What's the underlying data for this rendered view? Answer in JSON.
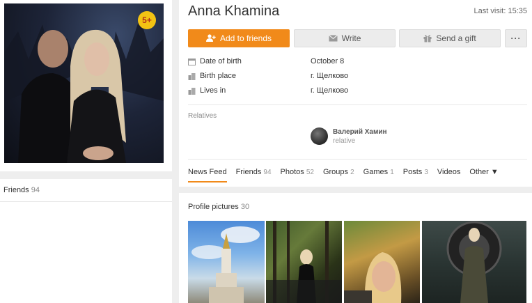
{
  "profile": {
    "name": "Anna Khamina",
    "last_visit_label": "Last visit:",
    "last_visit_time": "15:35",
    "age_badge": "5+"
  },
  "actions": {
    "add_friend": "Add to friends",
    "write": "Write",
    "gift": "Send a gift",
    "more": "···"
  },
  "info": [
    {
      "label": "Date of birth",
      "value": "October 8",
      "icon": "calendar-icon"
    },
    {
      "label": "Birth place",
      "value": "г. Щелково",
      "icon": "city-icon"
    },
    {
      "label": "Lives in",
      "value": "г. Щелково",
      "icon": "city-icon"
    }
  ],
  "relatives": {
    "label": "Relatives",
    "name": "Валерий Хамин",
    "role": "relative"
  },
  "tabs": [
    {
      "label": "News Feed",
      "count": ""
    },
    {
      "label": "Friends",
      "count": "94"
    },
    {
      "label": "Photos",
      "count": "52"
    },
    {
      "label": "Groups",
      "count": "2"
    },
    {
      "label": "Games",
      "count": "1"
    },
    {
      "label": "Posts",
      "count": "3"
    },
    {
      "label": "Videos",
      "count": ""
    },
    {
      "label": "Other ▼",
      "count": ""
    }
  ],
  "friends": {
    "label": "Friends",
    "count": "94"
  },
  "pictures": {
    "label": "Profile pictures",
    "count": "30"
  },
  "colors": {
    "accent": "#f18a1a",
    "badge": "#f3c313"
  }
}
